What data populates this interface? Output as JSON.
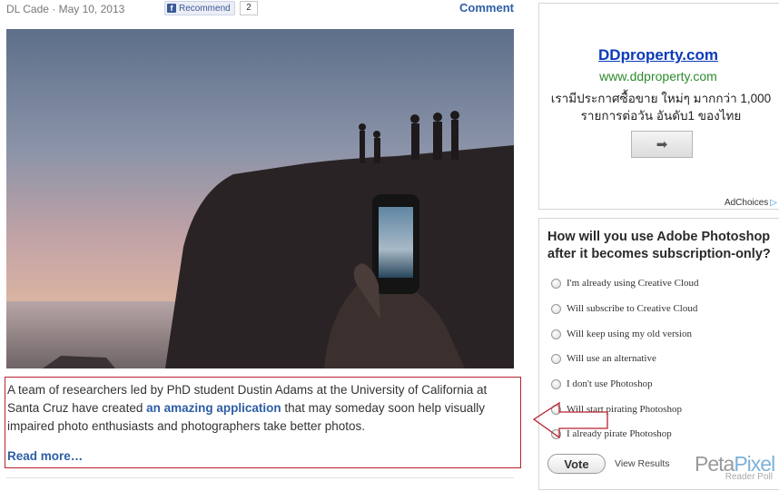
{
  "article": {
    "byline": "DL Cade · May 10, 2013",
    "recommend_label": "Recommend",
    "recommend_count": "2",
    "comment_label": "Comment",
    "excerpt_before": "A team of researchers led by PhD student Dustin Adams at the University of California at Santa Cruz have created ",
    "excerpt_link": "an amazing application",
    "excerpt_after": " that may someday soon help visually impaired photo enthusiasts and photographers take better photos.",
    "read_more": "Read more…"
  },
  "ad": {
    "title": "DDproperty.com",
    "url": "www.ddproperty.com",
    "description": "เรามีประกาศซื้อขาย ใหม่ๆ มากกว่า 1,000 รายการต่อวัน อันดับ1 ของไทย",
    "arrow_symbol": "➡",
    "adchoices": "AdChoices",
    "adchoices_icon": "▷"
  },
  "poll": {
    "question": "How will you use Adobe Photoshop after it becomes subscription-only?",
    "options": [
      "I'm already using Creative Cloud",
      "Will subscribe to Creative Cloud",
      "Will keep using my old version",
      "Will use an alternative",
      "I don't use Photoshop",
      "Will start pirating Photoshop",
      "I already pirate Photoshop"
    ],
    "vote_label": "Vote",
    "view_results": "View Results",
    "logo_peta": "Peta",
    "logo_pixel": "Pixel",
    "logo_sub": "Reader Poll"
  },
  "colors": {
    "link": "#2d5ea6",
    "annotation": "#b8232f",
    "ad_title": "#0a3bb8",
    "ad_url": "#2f8a2f"
  }
}
